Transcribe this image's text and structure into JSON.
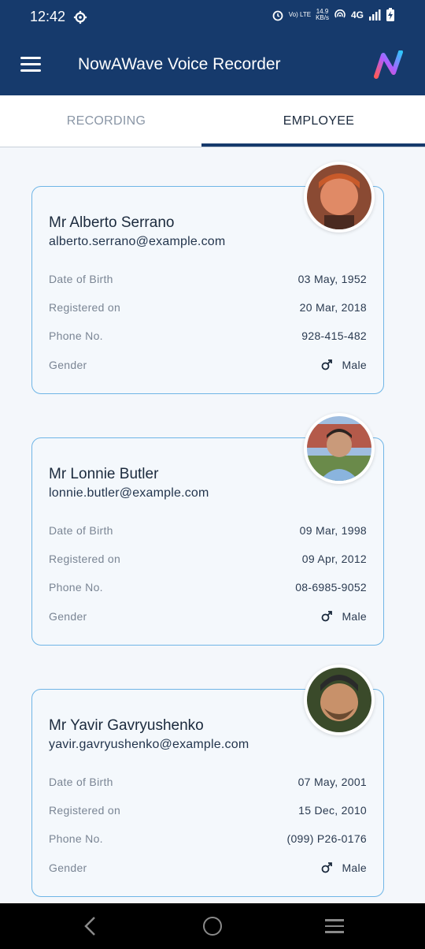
{
  "status_bar": {
    "time": "12:42",
    "net_speed": "14.9",
    "net_speed_unit": "KB/s",
    "volte": "Vo) LTE",
    "network": "4G"
  },
  "app_bar": {
    "title": "NowAWave Voice Recorder",
    "menu_icon": "hamburger-menu-icon",
    "logo_icon": "nowawave-logo"
  },
  "tabs": [
    {
      "label": "RECORDING",
      "active": false
    },
    {
      "label": "EMPLOYEE",
      "active": true
    }
  ],
  "labels": {
    "dob": "Date of Birth",
    "registered": "Registered on",
    "phone": "Phone No.",
    "gender": "Gender"
  },
  "employees": [
    {
      "name": "Mr Alberto Serrano",
      "email": "alberto.serrano@example.com",
      "dob": "03 May, 1952",
      "registered": "20 Mar, 2018",
      "phone": "928-415-482",
      "gender": "Male"
    },
    {
      "name": "Mr Lonnie Butler",
      "email": "lonnie.butler@example.com",
      "dob": "09 Mar, 1998",
      "registered": "09 Apr, 2012",
      "phone": "08-6985-9052",
      "gender": "Male"
    },
    {
      "name": "Mr Yavir Gavryushenko",
      "email": "yavir.gavryushenko@example.com",
      "dob": "07 May, 2001",
      "registered": "15 Dec, 2010",
      "phone": "(099) P26-0176",
      "gender": "Male"
    }
  ],
  "colors": {
    "primary": "#163a6c",
    "card_border": "#6fb5e6",
    "background": "#f4f7fb"
  }
}
